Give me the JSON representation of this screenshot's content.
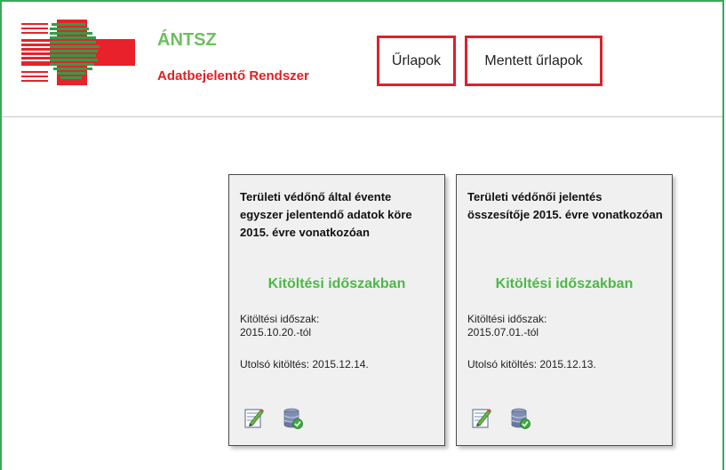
{
  "brand": {
    "title": "ÁNTSZ",
    "subtitle": "Adatbejelentő Rendszer"
  },
  "nav": {
    "forms_label": "Űrlapok",
    "saved_label": "Mentett űrlapok"
  },
  "colors": {
    "frame_green": "#3aaa55",
    "brand_green": "#6cbf60",
    "brand_red": "#e02020",
    "highlight_red": "#d9232d",
    "status_green": "#4db848"
  },
  "cards": [
    {
      "title": "Területi védőnő által évente egyszer jelentendő adatok köre 2015. évre vonatkozóan",
      "status": "Kitöltési időszakban",
      "period_label": "Kitöltési időszak:",
      "period_value": "2015.10.20.-tól",
      "last_fill": "Utolsó kitöltés: 2015.12.14.",
      "icons": [
        "edit-form-icon",
        "database-check-icon"
      ]
    },
    {
      "title": "Területi védőnői jelentés összesítője 2015. évre vonatkozóan",
      "status": "Kitöltési időszakban",
      "period_label": "Kitöltési időszak:",
      "period_value": "2015.07.01.-tól",
      "last_fill": "Utolsó kitöltés: 2015.12.13.",
      "icons": [
        "edit-form-icon",
        "database-check-icon"
      ]
    }
  ]
}
